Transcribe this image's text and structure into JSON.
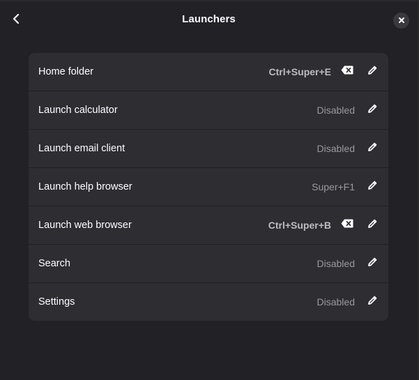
{
  "header": {
    "title": "Launchers",
    "back_icon": "back-arrow-icon",
    "close_icon": "close-icon"
  },
  "shortcuts": [
    {
      "label": "Home folder",
      "value": "Ctrl+Super+E",
      "assigned": true
    },
    {
      "label": "Launch calculator",
      "value": "Disabled",
      "assigned": false
    },
    {
      "label": "Launch email client",
      "value": "Disabled",
      "assigned": false
    },
    {
      "label": "Launch help browser",
      "value": "Super+F1",
      "assigned": false
    },
    {
      "label": "Launch web browser",
      "value": "Ctrl+Super+B",
      "assigned": true
    },
    {
      "label": "Search",
      "value": "Disabled",
      "assigned": false
    },
    {
      "label": "Settings",
      "value": "Disabled",
      "assigned": false
    }
  ],
  "icons": {
    "clear": "backspace-icon",
    "edit": "pencil-icon"
  },
  "colors": {
    "background": "#222226",
    "card": "#2e2e32",
    "text": "#ffffff",
    "muted": "#9a9a9e"
  }
}
